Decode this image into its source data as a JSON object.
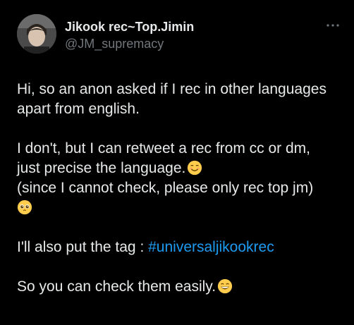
{
  "author": {
    "display_name": "Jikook rec~Top.Jimin",
    "handle": "@JM_supremacy"
  },
  "tweet": {
    "line1": "Hi, so an anon asked if I rec in other languages",
    "line2": "apart from english.",
    "line3": "I don't, but I can retweet a rec from cc or dm,",
    "line4": "just precise the language.",
    "line5": "(since I cannot check, please only rec top jm)",
    "line6_prefix": "I'll also put the tag : ",
    "hashtag": "#universaljikookrec",
    "line7": "So you can check them easily.",
    "emojis": [
      "smiling-face-emoji",
      "pleading-face-emoji",
      "grinning-face-emoji"
    ]
  },
  "icons": {
    "more": "more-dots-icon"
  },
  "colors": {
    "background": "#000000",
    "text": "#e7e9ea",
    "secondary": "#71767b",
    "link": "#1d9bf0"
  }
}
